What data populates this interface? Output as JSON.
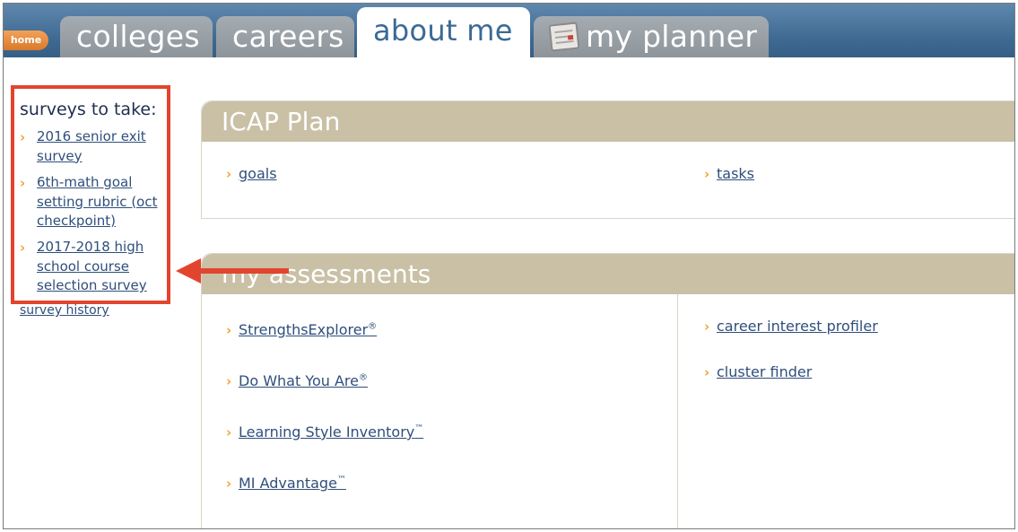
{
  "nav": {
    "home": "home",
    "tabs": [
      "colleges",
      "careers",
      "about me",
      "my planner"
    ]
  },
  "sidebar": {
    "title": "surveys to take:",
    "surveys": [
      "2016 senior exit survey",
      "6th-math goal setting rubric (oct checkpoint)",
      "2017-2018 high school course selection survey"
    ],
    "history_link": "survey history"
  },
  "icap": {
    "title": "ICAP Plan",
    "links": [
      "goals",
      "tasks"
    ]
  },
  "assessments": {
    "title": "my assessments",
    "left_links": [
      {
        "label": "StrengthsExplorer",
        "mark": "®"
      },
      {
        "label": "Do What You Are",
        "mark": "®"
      },
      {
        "label": "Learning Style Inventory",
        "mark": "™"
      },
      {
        "label": "MI Advantage",
        "mark": "™"
      }
    ],
    "right_links": [
      "career interest profiler",
      "cluster finder"
    ]
  },
  "icons": {
    "chevron": "chevron-right-icon",
    "planner": "planner-icon",
    "callout": "red-arrow-icon"
  },
  "colors": {
    "accent_red": "#e2452e",
    "header_blue": "#3d6890",
    "panel_tan": "#c9c0a6",
    "chevron_orange": "#f0a52f"
  }
}
